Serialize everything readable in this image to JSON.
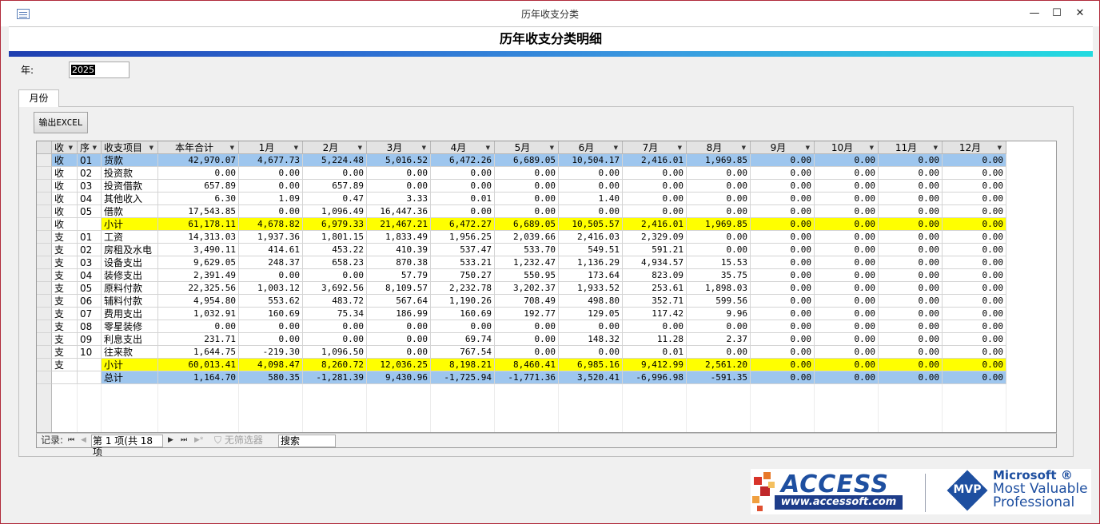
{
  "window": {
    "title": "历年收支分类",
    "minimize": "—",
    "maximize": "☐",
    "close": "✕"
  },
  "header": {
    "heading": "历年收支分类明细"
  },
  "filter": {
    "year_label": "年:",
    "year_value": "2025"
  },
  "tab": {
    "label": "月份"
  },
  "toolbar": {
    "export_label": "输出EXCEL"
  },
  "columns": [
    "收",
    "序",
    "收支项目",
    "本年合计",
    "1月",
    "2月",
    "3月",
    "4月",
    "5月",
    "6月",
    "7月",
    "8月",
    "9月",
    "10月",
    "11月",
    "12月"
  ],
  "rows": [
    [
      "收",
      "01",
      "货款",
      "42,970.07",
      "4,677.73",
      "5,224.48",
      "5,016.52",
      "6,472.26",
      "6,689.05",
      "10,504.17",
      "2,416.01",
      "1,969.85",
      "0.00",
      "0.00",
      "0.00",
      "0.00"
    ],
    [
      "收",
      "02",
      "投资款",
      "0.00",
      "0.00",
      "0.00",
      "0.00",
      "0.00",
      "0.00",
      "0.00",
      "0.00",
      "0.00",
      "0.00",
      "0.00",
      "0.00",
      "0.00"
    ],
    [
      "收",
      "03",
      "投资借款",
      "657.89",
      "0.00",
      "657.89",
      "0.00",
      "0.00",
      "0.00",
      "0.00",
      "0.00",
      "0.00",
      "0.00",
      "0.00",
      "0.00",
      "0.00"
    ],
    [
      "收",
      "04",
      "其他收入",
      "6.30",
      "1.09",
      "0.47",
      "3.33",
      "0.01",
      "0.00",
      "1.40",
      "0.00",
      "0.00",
      "0.00",
      "0.00",
      "0.00",
      "0.00"
    ],
    [
      "收",
      "05",
      "借款",
      "17,543.85",
      "0.00",
      "1,096.49",
      "16,447.36",
      "0.00",
      "0.00",
      "0.00",
      "0.00",
      "0.00",
      "0.00",
      "0.00",
      "0.00",
      "0.00"
    ],
    [
      "收",
      "",
      "小计",
      "61,178.11",
      "4,678.82",
      "6,979.33",
      "21,467.21",
      "6,472.27",
      "6,689.05",
      "10,505.57",
      "2,416.01",
      "1,969.85",
      "0.00",
      "0.00",
      "0.00",
      "0.00"
    ],
    [
      "支",
      "01",
      "工资",
      "14,313.03",
      "1,937.36",
      "1,801.15",
      "1,833.49",
      "1,956.25",
      "2,039.66",
      "2,416.03",
      "2,329.09",
      "0.00",
      "0.00",
      "0.00",
      "0.00",
      "0.00"
    ],
    [
      "支",
      "02",
      "房租及水电",
      "3,490.11",
      "414.61",
      "453.22",
      "410.39",
      "537.47",
      "533.70",
      "549.51",
      "591.21",
      "0.00",
      "0.00",
      "0.00",
      "0.00",
      "0.00"
    ],
    [
      "支",
      "03",
      "设备支出",
      "9,629.05",
      "248.37",
      "658.23",
      "870.38",
      "533.21",
      "1,232.47",
      "1,136.29",
      "4,934.57",
      "15.53",
      "0.00",
      "0.00",
      "0.00",
      "0.00"
    ],
    [
      "支",
      "04",
      "装修支出",
      "2,391.49",
      "0.00",
      "0.00",
      "57.79",
      "750.27",
      "550.95",
      "173.64",
      "823.09",
      "35.75",
      "0.00",
      "0.00",
      "0.00",
      "0.00"
    ],
    [
      "支",
      "05",
      "原料付款",
      "22,325.56",
      "1,003.12",
      "3,692.56",
      "8,109.57",
      "2,232.78",
      "3,202.37",
      "1,933.52",
      "253.61",
      "1,898.03",
      "0.00",
      "0.00",
      "0.00",
      "0.00"
    ],
    [
      "支",
      "06",
      "辅料付款",
      "4,954.80",
      "553.62",
      "483.72",
      "567.64",
      "1,190.26",
      "708.49",
      "498.80",
      "352.71",
      "599.56",
      "0.00",
      "0.00",
      "0.00",
      "0.00"
    ],
    [
      "支",
      "07",
      "费用支出",
      "1,032.91",
      "160.69",
      "75.34",
      "186.99",
      "160.69",
      "192.77",
      "129.05",
      "117.42",
      "9.96",
      "0.00",
      "0.00",
      "0.00",
      "0.00"
    ],
    [
      "支",
      "08",
      "零星装修",
      "0.00",
      "0.00",
      "0.00",
      "0.00",
      "0.00",
      "0.00",
      "0.00",
      "0.00",
      "0.00",
      "0.00",
      "0.00",
      "0.00",
      "0.00"
    ],
    [
      "支",
      "09",
      "利息支出",
      "231.71",
      "0.00",
      "0.00",
      "0.00",
      "69.74",
      "0.00",
      "148.32",
      "11.28",
      "2.37",
      "0.00",
      "0.00",
      "0.00",
      "0.00"
    ],
    [
      "支",
      "10",
      "往来款",
      "1,644.75",
      "-219.30",
      "1,096.50",
      "0.00",
      "767.54",
      "0.00",
      "0.00",
      "0.01",
      "0.00",
      "0.00",
      "0.00",
      "0.00",
      "0.00"
    ],
    [
      "支",
      "",
      "小计",
      "60,013.41",
      "4,098.47",
      "8,260.72",
      "12,036.25",
      "8,198.21",
      "8,460.41",
      "6,985.16",
      "9,412.99",
      "2,561.20",
      "0.00",
      "0.00",
      "0.00",
      "0.00"
    ],
    [
      "",
      "",
      "总计",
      "1,164.70",
      "580.35",
      "-1,281.39",
      "9,430.96",
      "-1,725.94",
      "-1,771.36",
      "3,520.41",
      "-6,996.98",
      "-591.35",
      "0.00",
      "0.00",
      "0.00",
      "0.00"
    ]
  ],
  "navigation": {
    "record_label": "记录:",
    "record_position": "第 1 项(共 18 项",
    "first": "⏮",
    "prev": "◀",
    "next": "▶",
    "last": "⏭",
    "new": "▶*",
    "filter_label": "无筛选器",
    "search_placeholder": "搜索"
  },
  "branding": {
    "access_name": "ACCESS",
    "access_url": "www.accessoft.com",
    "mvp_badge": "MVP",
    "ms_line1": "Microsoft ®",
    "ms_line2": "Most Valuable",
    "ms_line3": "Professional"
  },
  "colors": {
    "accent_blue": "#9ec6ee",
    "subtotal_yellow": "#ffff00",
    "frame_red": "#b02a3a"
  }
}
